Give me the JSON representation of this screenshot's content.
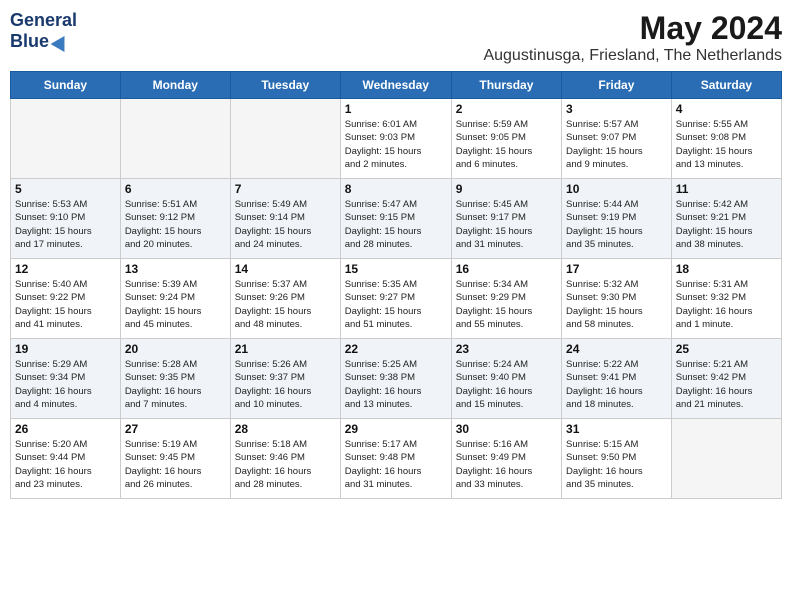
{
  "header": {
    "logo_general": "General",
    "logo_blue": "Blue",
    "month": "May 2024",
    "location": "Augustinusga, Friesland, The Netherlands"
  },
  "days_of_week": [
    "Sunday",
    "Monday",
    "Tuesday",
    "Wednesday",
    "Thursday",
    "Friday",
    "Saturday"
  ],
  "weeks": [
    [
      {
        "day": "",
        "info": ""
      },
      {
        "day": "",
        "info": ""
      },
      {
        "day": "",
        "info": ""
      },
      {
        "day": "1",
        "info": "Sunrise: 6:01 AM\nSunset: 9:03 PM\nDaylight: 15 hours\nand 2 minutes."
      },
      {
        "day": "2",
        "info": "Sunrise: 5:59 AM\nSunset: 9:05 PM\nDaylight: 15 hours\nand 6 minutes."
      },
      {
        "day": "3",
        "info": "Sunrise: 5:57 AM\nSunset: 9:07 PM\nDaylight: 15 hours\nand 9 minutes."
      },
      {
        "day": "4",
        "info": "Sunrise: 5:55 AM\nSunset: 9:08 PM\nDaylight: 15 hours\nand 13 minutes."
      }
    ],
    [
      {
        "day": "5",
        "info": "Sunrise: 5:53 AM\nSunset: 9:10 PM\nDaylight: 15 hours\nand 17 minutes."
      },
      {
        "day": "6",
        "info": "Sunrise: 5:51 AM\nSunset: 9:12 PM\nDaylight: 15 hours\nand 20 minutes."
      },
      {
        "day": "7",
        "info": "Sunrise: 5:49 AM\nSunset: 9:14 PM\nDaylight: 15 hours\nand 24 minutes."
      },
      {
        "day": "8",
        "info": "Sunrise: 5:47 AM\nSunset: 9:15 PM\nDaylight: 15 hours\nand 28 minutes."
      },
      {
        "day": "9",
        "info": "Sunrise: 5:45 AM\nSunset: 9:17 PM\nDaylight: 15 hours\nand 31 minutes."
      },
      {
        "day": "10",
        "info": "Sunrise: 5:44 AM\nSunset: 9:19 PM\nDaylight: 15 hours\nand 35 minutes."
      },
      {
        "day": "11",
        "info": "Sunrise: 5:42 AM\nSunset: 9:21 PM\nDaylight: 15 hours\nand 38 minutes."
      }
    ],
    [
      {
        "day": "12",
        "info": "Sunrise: 5:40 AM\nSunset: 9:22 PM\nDaylight: 15 hours\nand 41 minutes."
      },
      {
        "day": "13",
        "info": "Sunrise: 5:39 AM\nSunset: 9:24 PM\nDaylight: 15 hours\nand 45 minutes."
      },
      {
        "day": "14",
        "info": "Sunrise: 5:37 AM\nSunset: 9:26 PM\nDaylight: 15 hours\nand 48 minutes."
      },
      {
        "day": "15",
        "info": "Sunrise: 5:35 AM\nSunset: 9:27 PM\nDaylight: 15 hours\nand 51 minutes."
      },
      {
        "day": "16",
        "info": "Sunrise: 5:34 AM\nSunset: 9:29 PM\nDaylight: 15 hours\nand 55 minutes."
      },
      {
        "day": "17",
        "info": "Sunrise: 5:32 AM\nSunset: 9:30 PM\nDaylight: 15 hours\nand 58 minutes."
      },
      {
        "day": "18",
        "info": "Sunrise: 5:31 AM\nSunset: 9:32 PM\nDaylight: 16 hours\nand 1 minute."
      }
    ],
    [
      {
        "day": "19",
        "info": "Sunrise: 5:29 AM\nSunset: 9:34 PM\nDaylight: 16 hours\nand 4 minutes."
      },
      {
        "day": "20",
        "info": "Sunrise: 5:28 AM\nSunset: 9:35 PM\nDaylight: 16 hours\nand 7 minutes."
      },
      {
        "day": "21",
        "info": "Sunrise: 5:26 AM\nSunset: 9:37 PM\nDaylight: 16 hours\nand 10 minutes."
      },
      {
        "day": "22",
        "info": "Sunrise: 5:25 AM\nSunset: 9:38 PM\nDaylight: 16 hours\nand 13 minutes."
      },
      {
        "day": "23",
        "info": "Sunrise: 5:24 AM\nSunset: 9:40 PM\nDaylight: 16 hours\nand 15 minutes."
      },
      {
        "day": "24",
        "info": "Sunrise: 5:22 AM\nSunset: 9:41 PM\nDaylight: 16 hours\nand 18 minutes."
      },
      {
        "day": "25",
        "info": "Sunrise: 5:21 AM\nSunset: 9:42 PM\nDaylight: 16 hours\nand 21 minutes."
      }
    ],
    [
      {
        "day": "26",
        "info": "Sunrise: 5:20 AM\nSunset: 9:44 PM\nDaylight: 16 hours\nand 23 minutes."
      },
      {
        "day": "27",
        "info": "Sunrise: 5:19 AM\nSunset: 9:45 PM\nDaylight: 16 hours\nand 26 minutes."
      },
      {
        "day": "28",
        "info": "Sunrise: 5:18 AM\nSunset: 9:46 PM\nDaylight: 16 hours\nand 28 minutes."
      },
      {
        "day": "29",
        "info": "Sunrise: 5:17 AM\nSunset: 9:48 PM\nDaylight: 16 hours\nand 31 minutes."
      },
      {
        "day": "30",
        "info": "Sunrise: 5:16 AM\nSunset: 9:49 PM\nDaylight: 16 hours\nand 33 minutes."
      },
      {
        "day": "31",
        "info": "Sunrise: 5:15 AM\nSunset: 9:50 PM\nDaylight: 16 hours\nand 35 minutes."
      },
      {
        "day": "",
        "info": ""
      }
    ]
  ]
}
